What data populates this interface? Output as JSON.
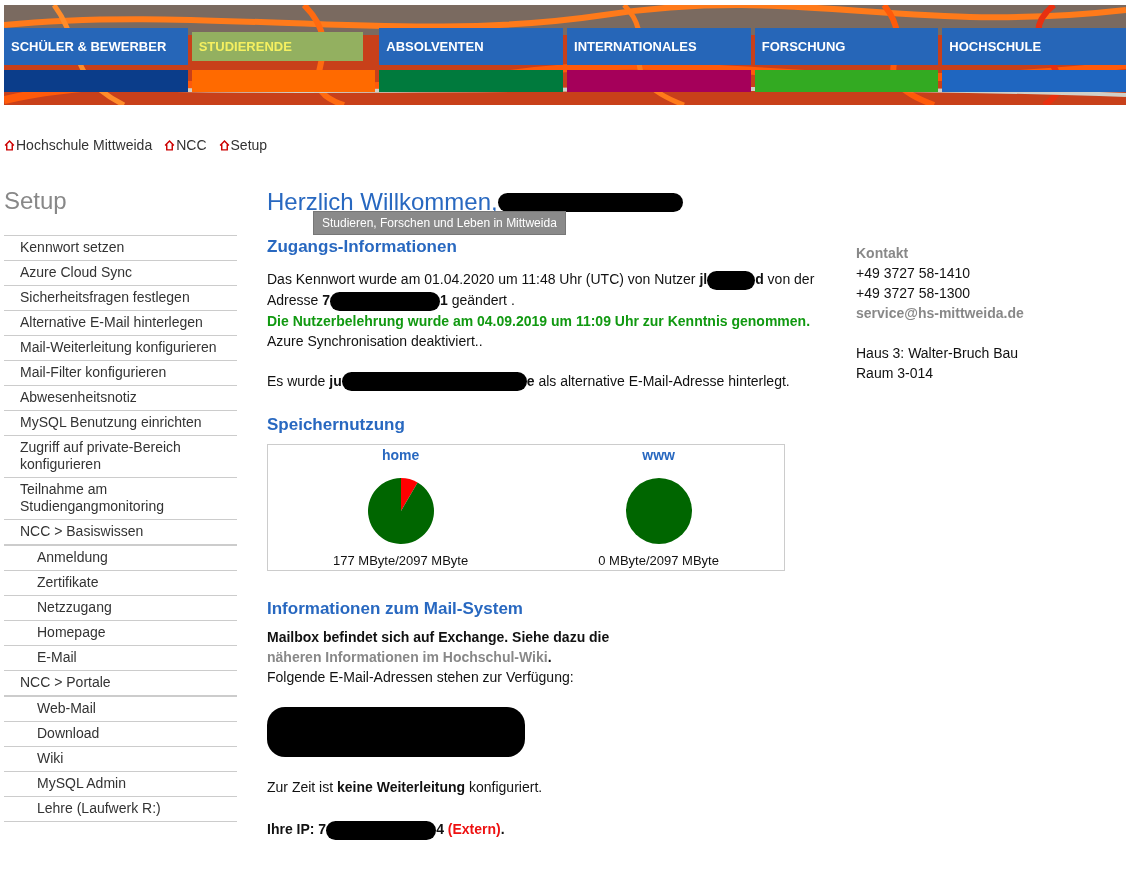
{
  "nav": [
    {
      "label": "SCHÜLER & BEWERBER",
      "selected": false,
      "color": "#0b3d8a"
    },
    {
      "label": "STUDIERENDE",
      "selected": true,
      "color": "#ff6a00"
    },
    {
      "label": "ABSOLVENTEN",
      "selected": false,
      "color": "#007a3d"
    },
    {
      "label": "INTERNATIONALES",
      "selected": false,
      "color": "#a5005a"
    },
    {
      "label": "FORSCHUNG",
      "selected": false,
      "color": "#33aa22"
    },
    {
      "label": "HOCHSCHULE",
      "selected": false,
      "color": "#1f66c0"
    }
  ],
  "breadcrumb": [
    "Hochschule Mittweida",
    "NCC",
    "Setup"
  ],
  "sidebar": {
    "title": "Setup",
    "items": [
      {
        "label": "Kennwort setzen"
      },
      {
        "label": "Azure Cloud Sync"
      },
      {
        "label": "Sicherheitsfragen festlegen"
      },
      {
        "label": "Alternative E-Mail hinterlegen"
      },
      {
        "label": "Mail-Weiterleitung konfigurieren"
      },
      {
        "label": "Mail-Filter konfigurieren"
      },
      {
        "label": "Abwesenheitsnotiz"
      },
      {
        "label": "MySQL Benutzung einrichten"
      },
      {
        "label": "Zugriff auf private-Bereich konfigurieren"
      },
      {
        "label": "Teilnahme am Studiengangmonitoring"
      },
      {
        "label": "NCC > Basiswissen",
        "children": [
          {
            "label": "Anmeldung"
          },
          {
            "label": "Zertifikate"
          },
          {
            "label": "Netzzugang"
          },
          {
            "label": "Homepage"
          },
          {
            "label": "E-Mail"
          }
        ]
      },
      {
        "label": "NCC > Portale",
        "children": [
          {
            "label": "Web-Mail"
          },
          {
            "label": "Download"
          },
          {
            "label": "Wiki"
          },
          {
            "label": "MySQL Admin"
          },
          {
            "label": "Lehre (Laufwerk R:)"
          }
        ]
      }
    ]
  },
  "greeting": [
    {
      "kind": "text",
      "text": "Herzlich Willkommen,"
    },
    {
      "kind": "redact-l"
    }
  ],
  "tooltip": "Studieren, Forschen und Leben in Mittweida",
  "access": {
    "heading": "Zugangs-Informationen",
    "paragraphs": [
      {
        "kind": "normal",
        "parts": [
          {
            "kind": "text",
            "text": "Das Kennwort wurde am 01.04.2020 um 11:48 Uhr (UTC) von Nutzer "
          },
          {
            "kind": "bold",
            "text": "jl"
          },
          {
            "kind": "redact-s"
          },
          {
            "kind": "bold",
            "text": "d"
          },
          {
            "kind": "text",
            "text": " von der Adresse "
          },
          {
            "kind": "bold",
            "text": "7"
          },
          {
            "kind": "redact-m"
          },
          {
            "kind": "bold",
            "text": "1"
          },
          {
            "kind": "text",
            "text": " geändert ."
          }
        ]
      },
      {
        "kind": "green",
        "parts": [
          {
            "kind": "text",
            "text": "Die Nutzerbelehrung wurde am 04.09.2019 um 11:09 Uhr zur Kenntnis genommen."
          }
        ]
      },
      {
        "kind": "normal",
        "parts": [
          {
            "kind": "text",
            "text": "Azure Synchronisation deaktiviert.."
          }
        ]
      },
      {
        "kind": "spaced",
        "parts": [
          {
            "kind": "text",
            "text": "Es wurde "
          },
          {
            "kind": "bold",
            "text": "ju"
          },
          {
            "kind": "redact-l"
          },
          {
            "kind": "bold",
            "text": "e"
          },
          {
            "kind": "text",
            "text": " als alternative E-Mail-Adresse hinterlegt."
          }
        ]
      }
    ]
  },
  "storage": {
    "heading": "Speichernutzung",
    "charts": [
      {
        "caption": "177 MByte/2097 MByte",
        "chart_data": {
          "type": "pie",
          "title": "home",
          "values": [
            8.4,
            91.6
          ]
        }
      },
      {
        "caption": "0 MByte/2097 MByte",
        "chart_data": {
          "type": "pie",
          "title": "www",
          "values": [
            0,
            100
          ]
        }
      }
    ]
  },
  "mail": {
    "heading": "Informationen zum Mail-System",
    "paragraphs": [
      {
        "kind": "bold",
        "parts": [
          {
            "kind": "text",
            "text": "Mailbox befindet sich auf Exchange. Siehe dazu die "
          },
          {
            "kind": "link",
            "text": "näheren Informationen im Hochschul-Wiki"
          },
          {
            "kind": "text",
            "text": "."
          }
        ]
      },
      {
        "kind": "normal",
        "parts": [
          {
            "kind": "text",
            "text": "Folgende E-Mail-Adressen stehen zur Verfügung:"
          }
        ]
      },
      {
        "kind": "block",
        "parts": [
          {
            "kind": "redact-xl"
          }
        ]
      },
      {
        "kind": "spaced",
        "parts": [
          {
            "kind": "text",
            "text": "Zur Zeit ist "
          },
          {
            "kind": "bold",
            "text": "keine Weiterleitung"
          },
          {
            "kind": "text",
            "text": " konfiguriert."
          }
        ]
      },
      {
        "kind": "bold-spaced",
        "parts": [
          {
            "kind": "text",
            "text": "Ihre IP: 7"
          },
          {
            "kind": "redact-m"
          },
          {
            "kind": "text",
            "text": "4 "
          },
          {
            "kind": "red",
            "text": "(Extern)"
          },
          {
            "kind": "text",
            "text": "."
          }
        ]
      }
    ]
  },
  "contact": {
    "heading": "Kontakt",
    "lines": [
      {
        "kind": "text",
        "text": "+49 3727 58-1410"
      },
      {
        "kind": "text",
        "text": "+49 3727 58-1300"
      },
      {
        "kind": "link",
        "text": "service@hs-mittweida.de"
      },
      {
        "kind": "gap",
        "text": "Haus 3: Walter-Bruch Bau"
      },
      {
        "kind": "text",
        "text": "Raum 3-014"
      }
    ]
  }
}
